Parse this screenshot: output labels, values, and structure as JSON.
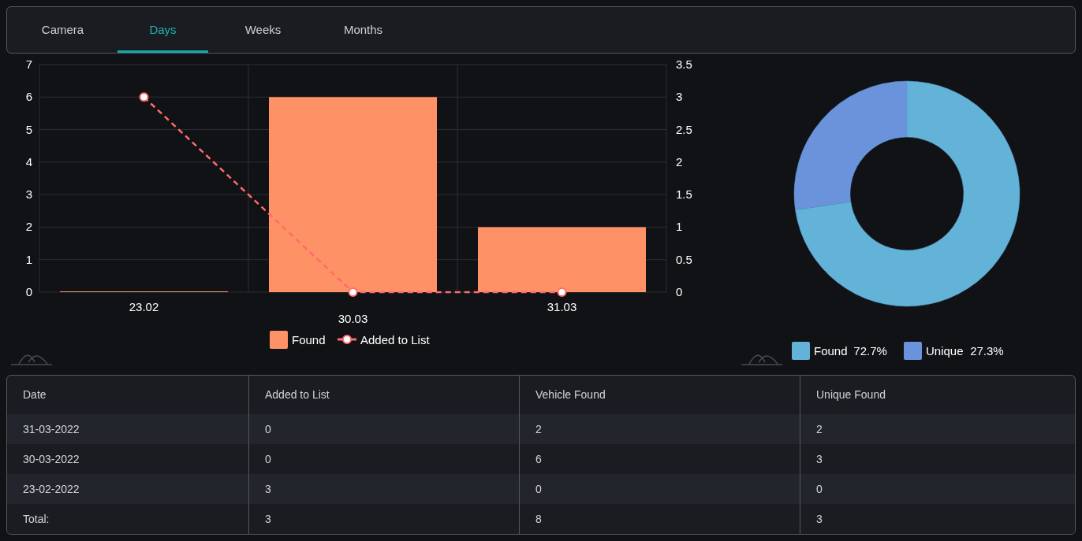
{
  "tabs": [
    {
      "label": "Camera",
      "selected": false
    },
    {
      "label": "Days",
      "selected": true
    },
    {
      "label": "Weeks",
      "selected": false
    },
    {
      "label": "Months",
      "selected": false
    }
  ],
  "bar_chart": {
    "chart_data": {
      "type": "bar",
      "categories": [
        "23.02",
        "30.03",
        "31.03"
      ],
      "series": [
        {
          "name": "Found",
          "color": "#ff9166",
          "values": [
            0,
            6,
            2
          ],
          "type": "bar"
        },
        {
          "name": "Added to List",
          "color": "#ff6b6b",
          "values": [
            3,
            0,
            0
          ],
          "type": "line",
          "line_style": "dashed",
          "marker": "circle",
          "axis": "y2"
        }
      ],
      "ylim": [
        0,
        7
      ],
      "grid": true,
      "legend": true,
      "yticks": [
        0,
        1,
        2,
        3,
        4,
        5,
        6,
        7
      ],
      "y2lim": [
        0,
        3.5
      ],
      "y2ticks": [
        0,
        0.5,
        1,
        1.5,
        2,
        2.5,
        3,
        3.5
      ]
    }
  },
  "donut_chart": {
    "chart_data": {
      "type": "donut",
      "categories": [
        "Found",
        "Unique"
      ],
      "values": [
        72.7,
        27.3
      ],
      "legend": true,
      "colors": [
        "#63b3d9",
        "#6a93dc"
      ],
      "value_labels": [
        "72.7%",
        "27.3%"
      ]
    }
  },
  "table": {
    "columns": [
      "Date",
      "Added to List",
      "Vehicle Found",
      "Unique Found"
    ],
    "rows": [
      [
        "31-03-2022",
        "0",
        "2",
        "2"
      ],
      [
        "30-03-2022",
        "0",
        "6",
        "3"
      ],
      [
        "23-02-2022",
        "3",
        "0",
        "0"
      ],
      [
        "Total:",
        "3",
        "8",
        "3"
      ]
    ]
  }
}
